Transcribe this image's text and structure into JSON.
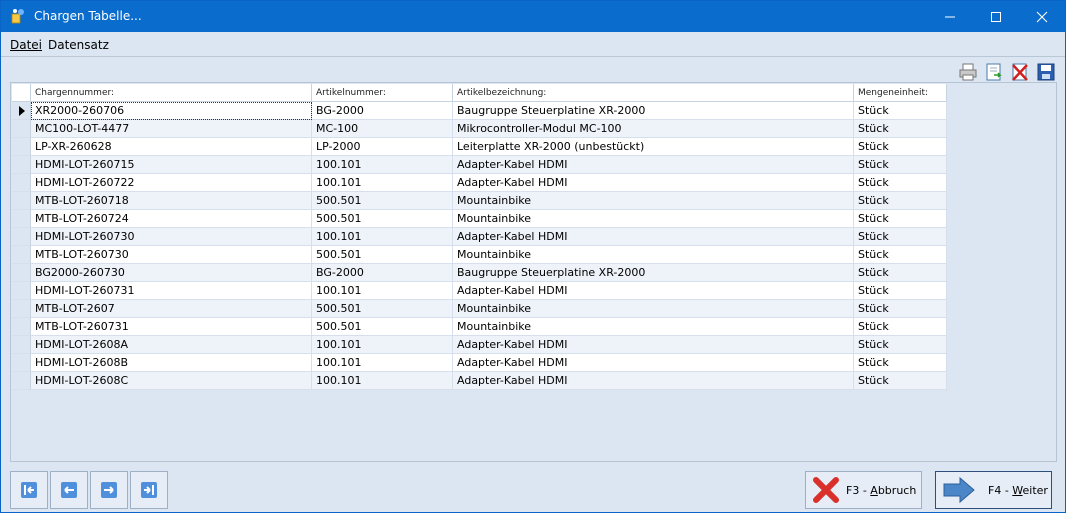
{
  "window": {
    "title": "Chargen Tabelle..."
  },
  "menu": {
    "datei": "Datei",
    "datensatz": "Datensatz"
  },
  "toolbar": {
    "icons": [
      "printer-icon",
      "export-icon",
      "delete-icon",
      "save-icon"
    ]
  },
  "table": {
    "columns": [
      "Chargennummer:",
      "Artikelnummer:",
      "Artikelbezeichnung:",
      "Mengeneinheit:"
    ],
    "current_row": 0,
    "rows": [
      [
        "XR2000-260706",
        "BG-2000",
        "Baugruppe Steuerplatine XR-2000",
        "Stück"
      ],
      [
        "MC100-LOT-4477",
        "MC-100",
        "Mikrocontroller-Modul MC-100",
        "Stück"
      ],
      [
        "LP-XR-260628",
        "LP-2000",
        "Leiterplatte XR-2000 (unbestückt)",
        "Stück"
      ],
      [
        "HDMI-LOT-260715",
        "100.101",
        "Adapter-Kabel HDMI",
        "Stück"
      ],
      [
        "HDMI-LOT-260722",
        "100.101",
        "Adapter-Kabel HDMI",
        "Stück"
      ],
      [
        "MTB-LOT-260718",
        "500.501",
        "Mountainbike",
        "Stück"
      ],
      [
        "MTB-LOT-260724",
        "500.501",
        "Mountainbike",
        "Stück"
      ],
      [
        "HDMI-LOT-260730",
        "100.101",
        "Adapter-Kabel HDMI",
        "Stück"
      ],
      [
        "MTB-LOT-260730",
        "500.501",
        "Mountainbike",
        "Stück"
      ],
      [
        "BG2000-260730",
        "BG-2000",
        "Baugruppe Steuerplatine XR-2000",
        "Stück"
      ],
      [
        "HDMI-LOT-260731",
        "100.101",
        "Adapter-Kabel HDMI",
        "Stück"
      ],
      [
        "MTB-LOT-2607",
        "500.501",
        "Mountainbike",
        "Stück"
      ],
      [
        "MTB-LOT-260731",
        "500.501",
        "Mountainbike",
        "Stück"
      ],
      [
        "HDMI-LOT-2608A",
        "100.101",
        "Adapter-Kabel HDMI",
        "Stück"
      ],
      [
        "HDMI-LOT-2608B",
        "100.101",
        "Adapter-Kabel HDMI",
        "Stück"
      ],
      [
        "HDMI-LOT-2608C",
        "100.101",
        "Adapter-Kabel HDMI",
        "Stück"
      ]
    ]
  },
  "buttons": {
    "abbruch_prefix": "F3 - ",
    "abbruch_key": "A",
    "abbruch_rest": "bbruch",
    "weiter_prefix": "F4 - ",
    "weiter_key": "W",
    "weiter_rest": "eiter"
  },
  "colors": {
    "titlebar": "#0a6ccc",
    "window_bg": "#dce6f2",
    "nav_arrow": "#3f7fd0",
    "cancel_red": "#d9302c",
    "next_arrow": "#4a86c8"
  }
}
